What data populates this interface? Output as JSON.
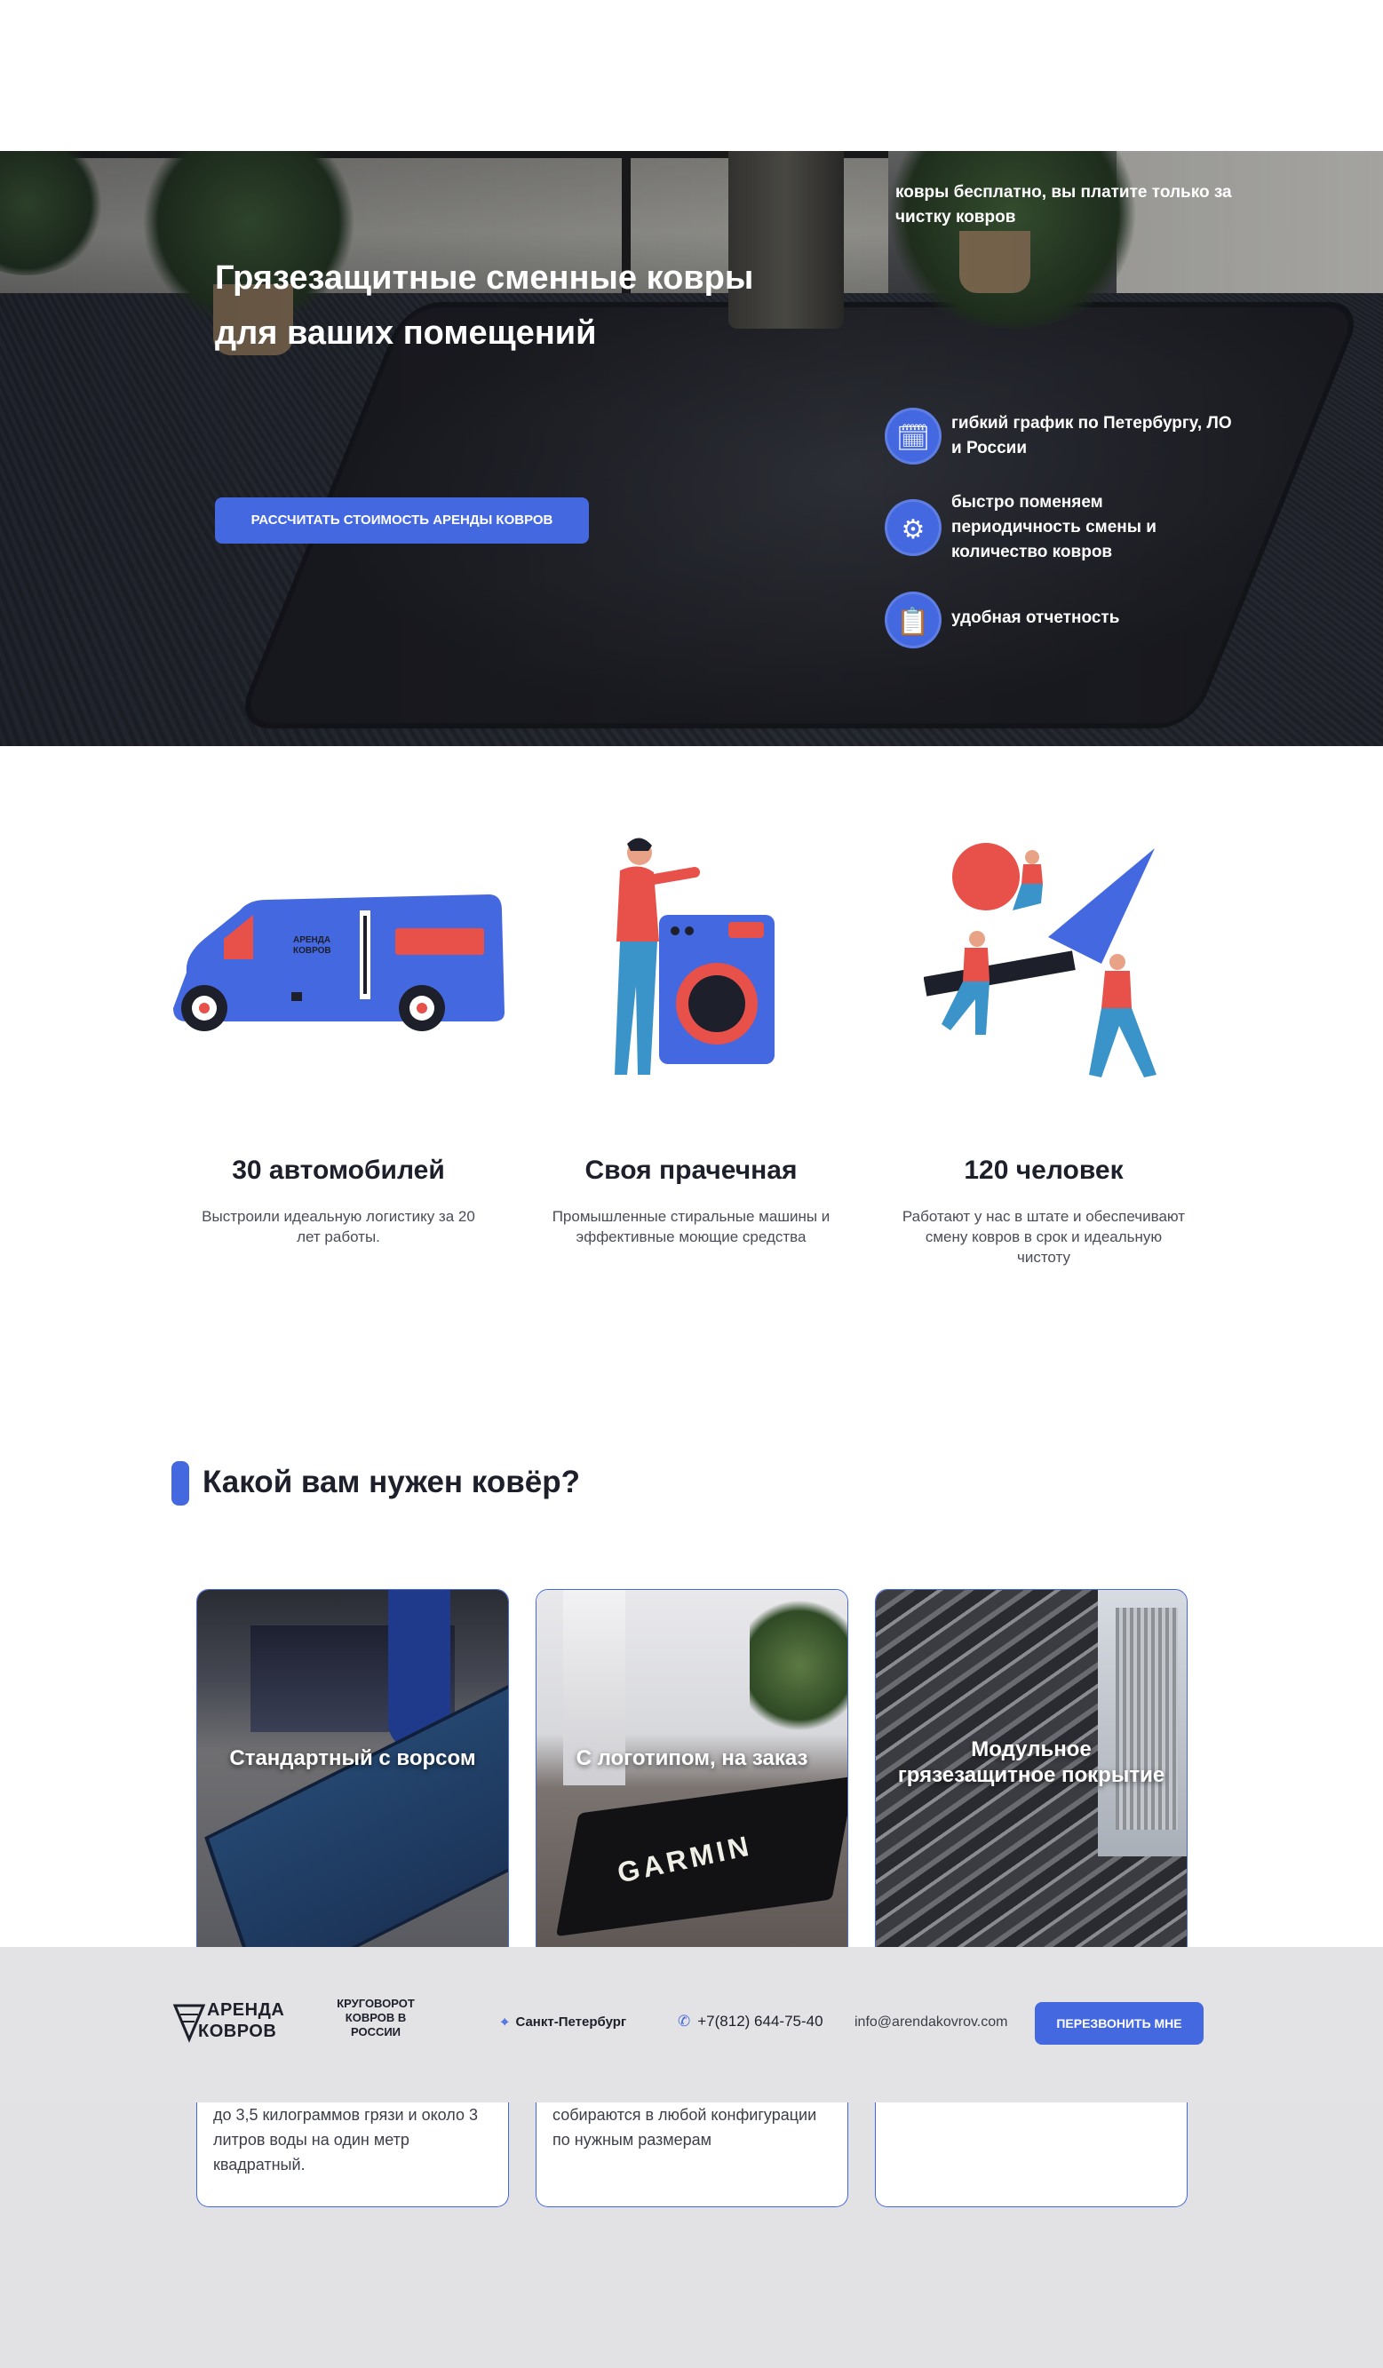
{
  "hero": {
    "title": "Грязезащитные сменные ковры для ваших помещений",
    "cta": "РАССЧИТАТЬ СТОИМОСТЬ АРЕНДЫ КОВРОВ",
    "intro": "ковры бесплатно, вы платите только за чистку ковров",
    "features": [
      {
        "icon": "schedule-icon",
        "glyph": "🗓",
        "text": "гибкий график по Петербургу, ЛО и России"
      },
      {
        "icon": "settings-cycle-icon",
        "glyph": "⚙",
        "text": "быстро поменяем периодичность смены и количество ковров"
      },
      {
        "icon": "report-clipboard-icon",
        "glyph": "📋",
        "text": "удобная отчетность"
      }
    ]
  },
  "stats": [
    {
      "title": "30 автомобилей",
      "text": "Выстроили идеальную логистику за 20 лет работы."
    },
    {
      "title": "Своя прачечная",
      "text": "Промышленные стиральные машины и эффективные моющие средства"
    },
    {
      "title": "120 человек",
      "text": "Работают у нас в штате и обеспечивают смену ковров в срок и идеальную чистоту"
    }
  ],
  "van_logo": {
    "line1": "АРЕНДА",
    "line2": "КОВРОВ"
  },
  "section": {
    "title": "Какой вам нужен ковёр?"
  },
  "cards": [
    {
      "caption": "Стандартный с ворсом",
      "desc": "до 3,5 килограммов грязи и около 3 литров воды на один метр квадратный."
    },
    {
      "caption": "С логотипом, на заказ",
      "desc": "собираются в любой конфигурации по нужным размерам",
      "logo": "GARMIN"
    },
    {
      "caption": "Модульное грязезащитное покрытие",
      "desc": ""
    }
  ],
  "footer": {
    "logo1_line1": "АРЕНДА",
    "logo1_line2": "КОВРОВ",
    "logo2": "КРУГОВОРОТ КОВРОВ В РОССИИ",
    "city": "Санкт-Петербург",
    "phone": "+7(812) 644-75-40",
    "email": "info@arendakovrov.com",
    "callback": "ПЕРЕЗВОНИТЬ МНЕ"
  },
  "colors": {
    "accent": "#4468e0",
    "coral": "#e8504a",
    "dark": "#1d1f2b",
    "footer_bg": "#e3e3e5"
  }
}
